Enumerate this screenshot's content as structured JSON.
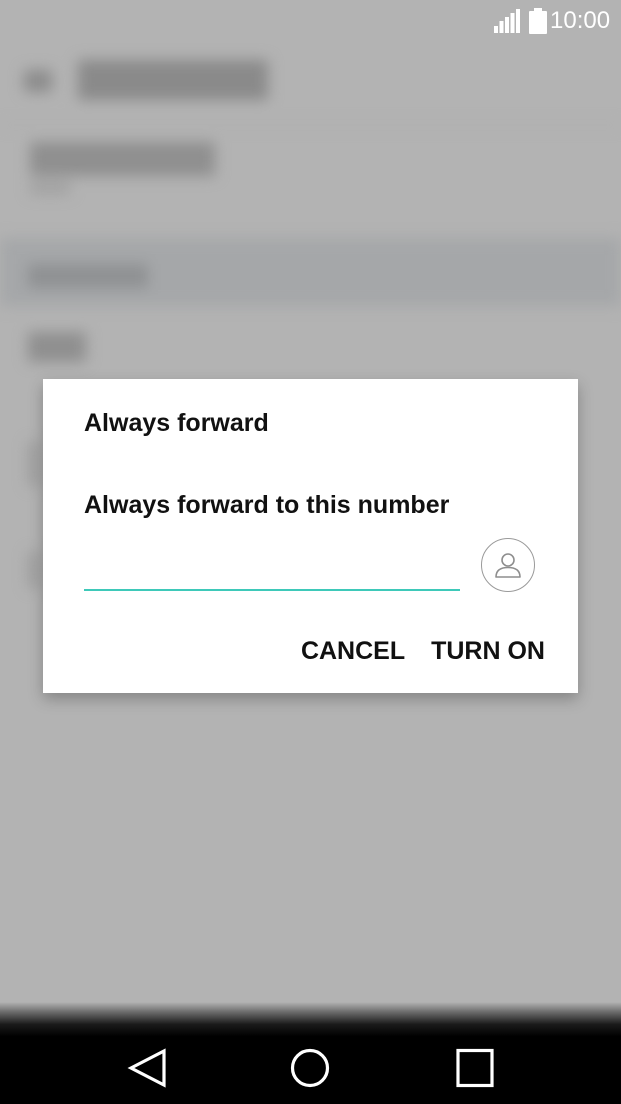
{
  "status_bar": {
    "time": "10:00",
    "icons": [
      "signal-icon",
      "battery-icon"
    ]
  },
  "dialog": {
    "title": "Always forward",
    "message": "Always forward to this number",
    "number_value": "",
    "contact_icon": "person-icon",
    "cancel_label": "CANCEL",
    "confirm_label": "TURN ON",
    "accent_color": "#3ec9b9"
  },
  "nav_bar": {
    "icons": [
      "back-icon",
      "home-icon",
      "recents-icon"
    ]
  }
}
